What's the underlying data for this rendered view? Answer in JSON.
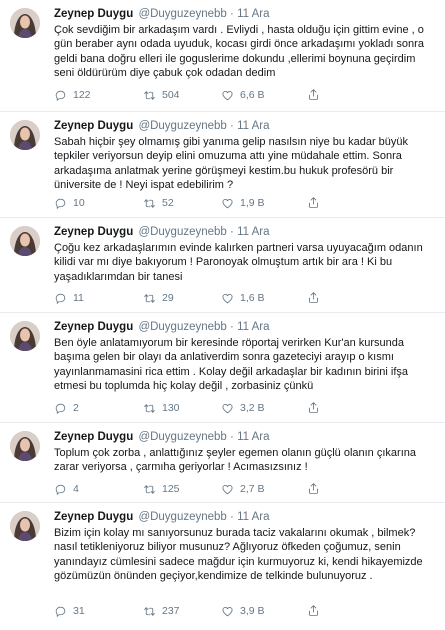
{
  "tweets": [
    {
      "name": "Zeynep Duygu",
      "handle": "@Duyguzeynebb",
      "dot": "·",
      "time": "11 Ara",
      "text": "Çok sevdiğim bir arkadaşım vardı . Evliydi , hasta olduğu için gittim evine , o gün beraber aynı odada uyuduk, kocası girdi önce arkadaşımı yokladı sonra geldi bana doğru elleri ile goguslerime dokundu ,ellerimi boynuna geçirdim seni öldürürüm diye  çabuk çok odadan dedim",
      "replies": "122",
      "retweets": "504",
      "likes": "6,6 B"
    },
    {
      "name": "Zeynep Duygu",
      "handle": "@Duyguzeynebb",
      "dot": "·",
      "time": "11 Ara",
      "text": "Sabah hiçbir şey olmamış gibi yanıma gelip nasılsın niye bu kadar büyük tepkiler veriyorsun deyip elini omuzuma attı yine müdahale ettim. Sonra arkadaşıma anlatmak yerine görüşmeyi kestim.bu hukuk profesörü bir üniversite de ! Neyi ispat edebilirim ?",
      "replies": "10",
      "retweets": "52",
      "likes": "1,9 B"
    },
    {
      "name": "Zeynep Duygu",
      "handle": "@Duyguzeynebb",
      "dot": "·",
      "time": "11 Ara",
      "text": "Çoğu kez  arkadaşlarımın evinde kalırken partneri varsa uyuyacağım odanın kilidi var mı diye bakıyorum ! Paronoyak olmuştum artık bir ara ! Ki bu yaşadıklarımdan bir tanesi",
      "replies": "11",
      "retweets": "29",
      "likes": "1,6 B"
    },
    {
      "name": "Zeynep Duygu",
      "handle": "@Duyguzeynebb",
      "dot": "·",
      "time": "11 Ara",
      "text": "Ben öyle anlatamıyorum bir keresinde röportaj verirken Kur'an kursunda başıma gelen bir olayı da anlativerdim sonra gazeteciyi arayıp o kısmı yayınlanmamasini rica ettim . Kolay değil arkadaşlar bir kadının birini ifşa etmesi bu toplumda hiç kolay değil , zorbasiniz çünkü",
      "replies": "2",
      "retweets": "130",
      "likes": "3,2 B"
    },
    {
      "name": "Zeynep Duygu",
      "handle": "@Duyguzeynebb",
      "dot": "·",
      "time": "11 Ara",
      "text": "Toplum çok zorba , anlattığınız şeyler egemen olanın güçlü olanın çıkarına zarar veriyorsa , çarmıha geriyorlar ! Acımasızsınız !",
      "replies": "4",
      "retweets": "125",
      "likes": "2,7 B"
    },
    {
      "name": "Zeynep Duygu",
      "handle": "@Duyguzeynebb",
      "dot": "·",
      "time": "11 Ara",
      "text": "Bizim için kolay mı sanıyorsunuz burada taciz vakalarını okumak , bilmek? nasıl tetikleniyoruz biliyor musunuz? Ağlıyoruz öfkeden çoğumuz, senin yanındayız cümlesini sadece mağdur için kurmuyoruz ki, kendi hikayemizde gözümüzün önünden geçiyor,kendimize de telkinde bulunuyoruz .",
      "replies": "31",
      "retweets": "237",
      "likes": "3,9 B"
    }
  ],
  "icons": {
    "reply": "reply-icon",
    "retweet": "retweet-icon",
    "like": "heart-icon",
    "share": "share-icon"
  },
  "colors": {
    "text": "#14171a",
    "muted": "#657786",
    "border": "#e6ecf0"
  }
}
